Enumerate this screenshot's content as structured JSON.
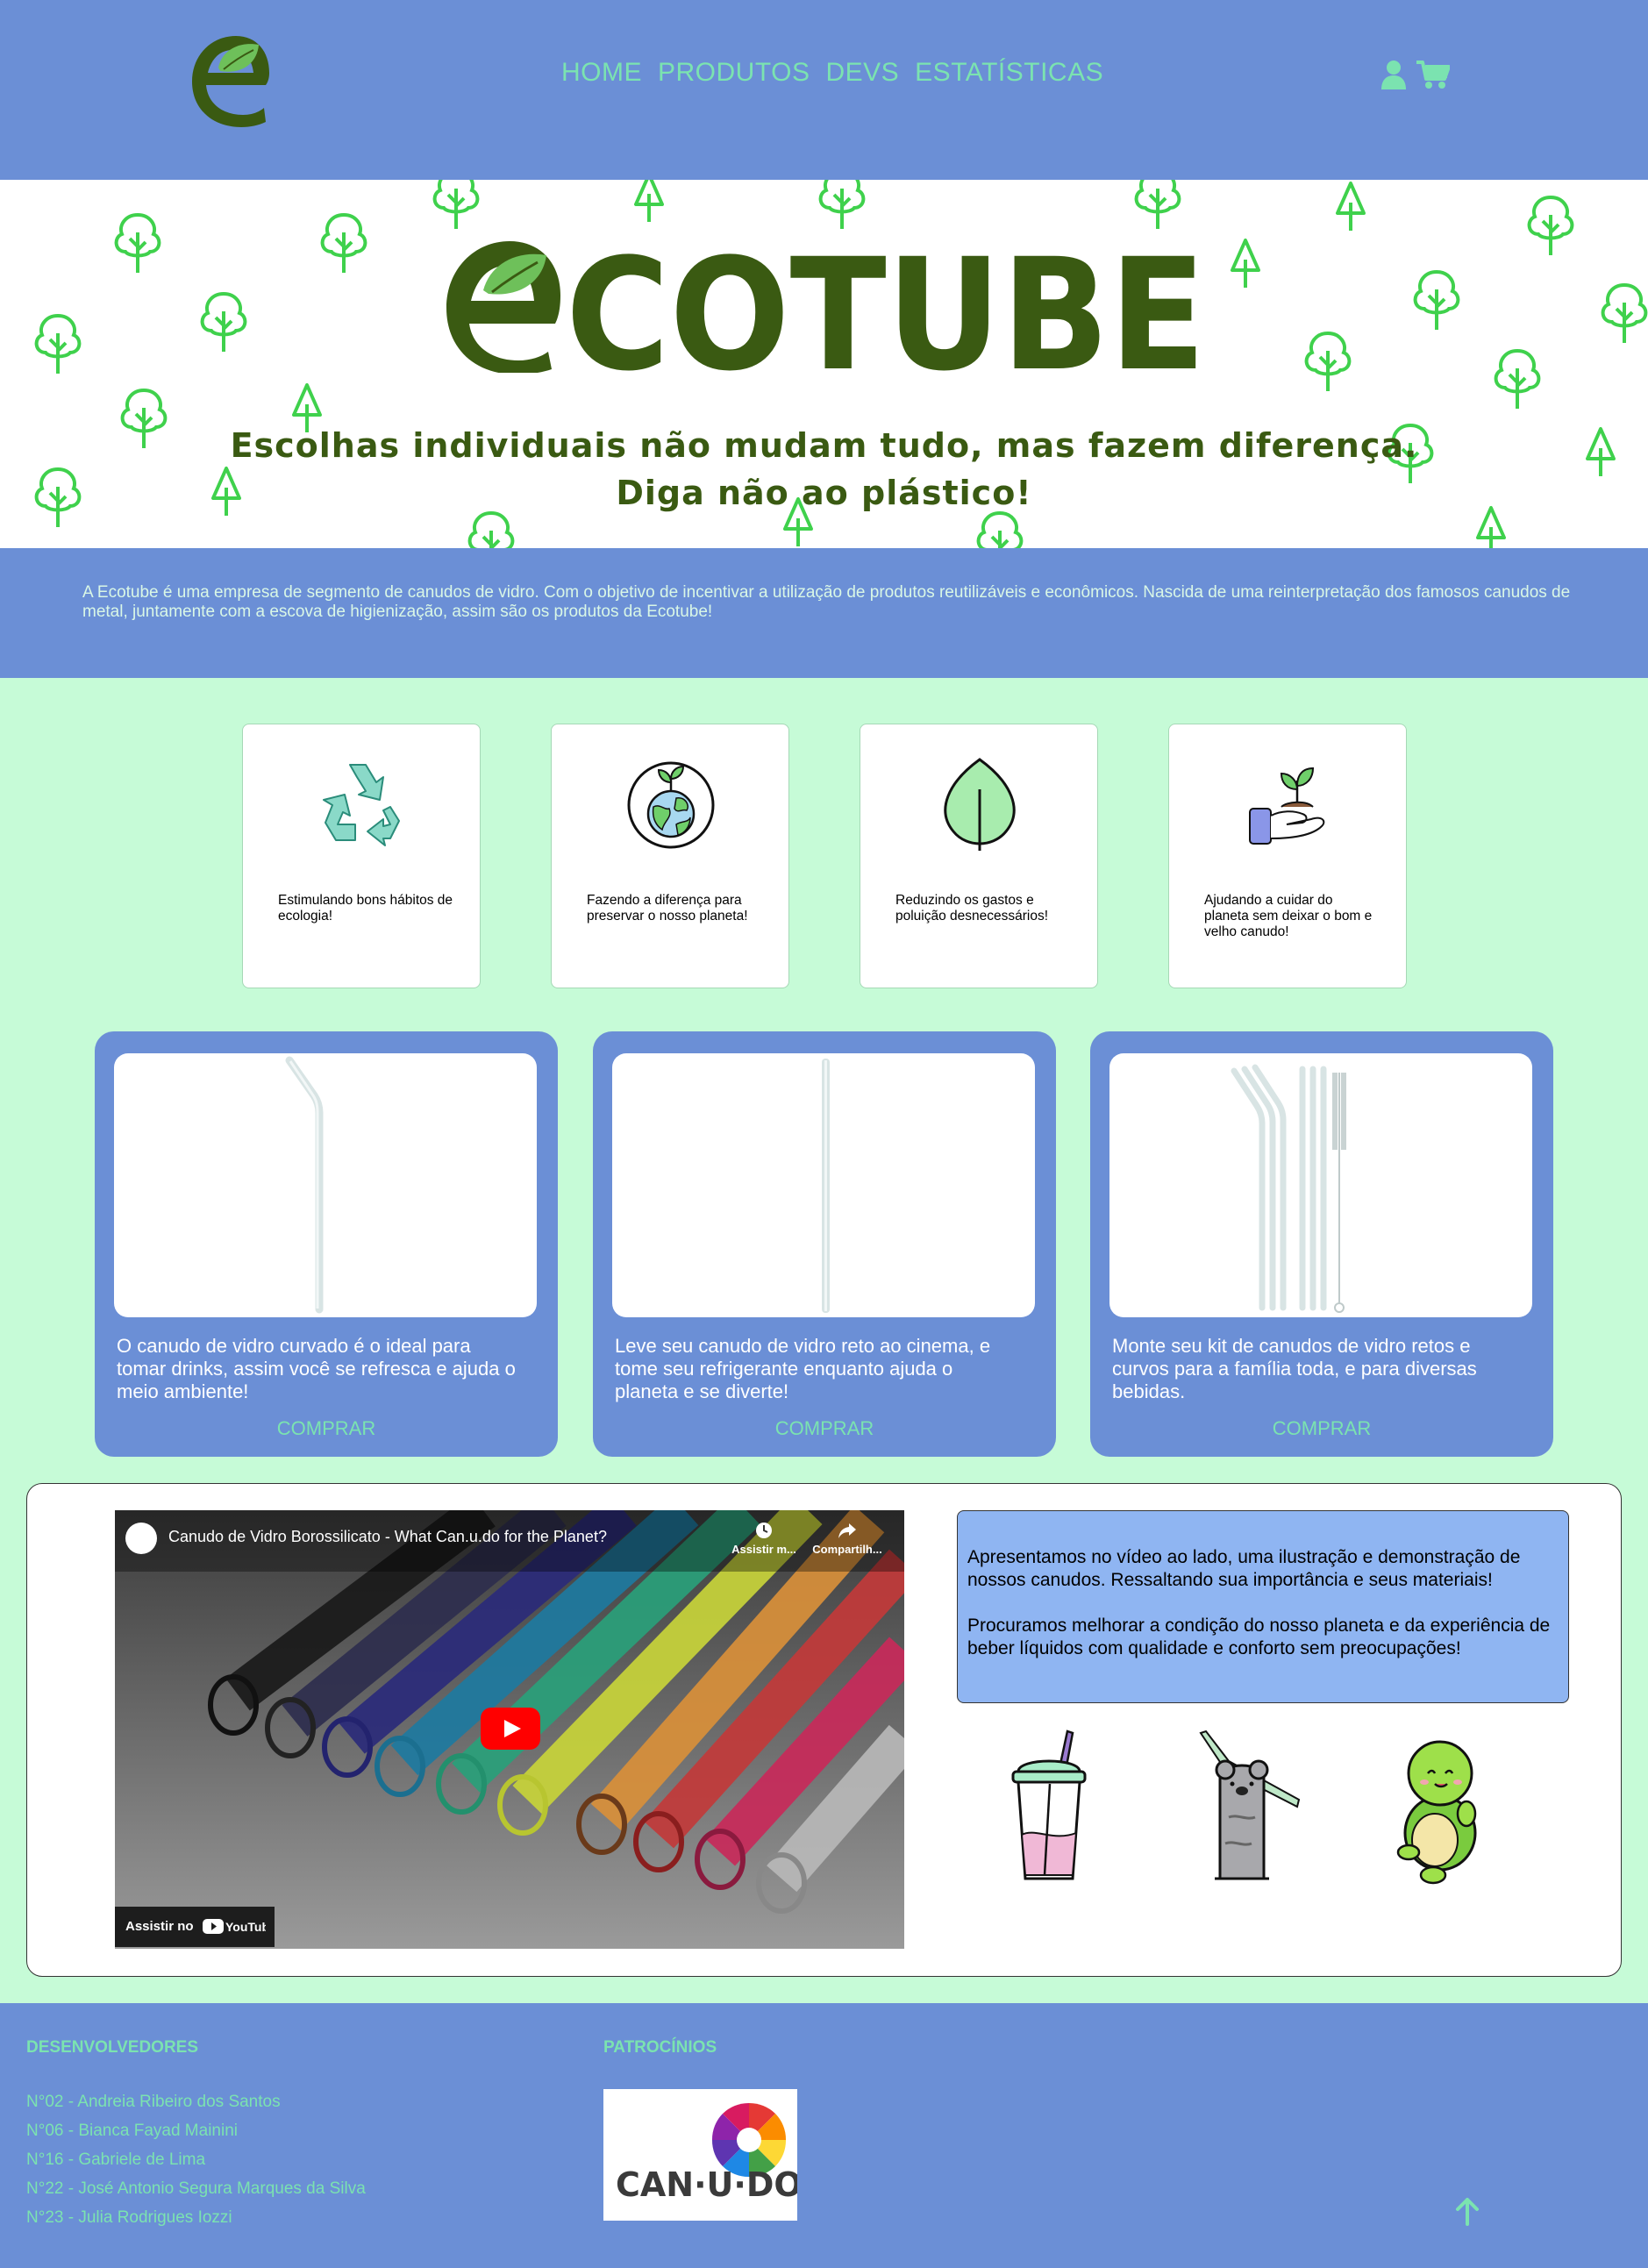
{
  "header": {
    "nav": [
      "HOME",
      "PRODUTOS",
      "DEVS",
      "ESTATÍSTICAS"
    ]
  },
  "hero": {
    "brand": "ECOTUBE",
    "tagline_line1": "Escolhas individuais não mudam tudo, mas fazem diferença.",
    "tagline_line2": "Diga não ao plástico!"
  },
  "about": {
    "text": "A Ecotube é uma empresa de segmento de canudos de vidro. Com o objetivo de incentivar a utilização de produtos reutilizáveis e econômicos. Nascida de uma reinterpretação dos famosos canudos de metal, juntamente com a escova de higienização, assim são os produtos da Ecotube!"
  },
  "features": [
    {
      "icon": "recycle-icon",
      "text": "Estimulando bons hábitos de ecologia!"
    },
    {
      "icon": "earth-sprout-icon",
      "text": "Fazendo a diferença para preservar o nosso planeta!"
    },
    {
      "icon": "leaf-icon",
      "text": "Reduzindo os gastos e poluição desnecessários!"
    },
    {
      "icon": "hand-plant-icon",
      "text": "Ajudando a cuidar do planeta sem deixar o bom e velho canudo!"
    }
  ],
  "products": [
    {
      "image": "curved-glass-straw",
      "description": "O canudo de vidro curvado é o ideal para tomar drinks, assim você se refresca e ajuda o meio ambiente!",
      "button": "COMPRAR"
    },
    {
      "image": "straight-glass-straw",
      "description": "Leve seu canudo de vidro reto ao cinema, e tome seu refrigerante enquanto ajuda o planeta e se diverte!",
      "button": "COMPRAR"
    },
    {
      "image": "straw-kit",
      "description": "Monte seu kit de canudos de vidro retos e curvos para a família toda, e para diversas bebidas.",
      "button": "COMPRAR"
    }
  ],
  "video": {
    "title": "Canudo de Vidro Borossilicato - What Can.u.do for the Planet?",
    "watch_later": "Assistir m...",
    "share": "Compartilh...",
    "watch_on": "Assistir no",
    "youtube": "YouTube"
  },
  "video_text": {
    "p1": "Apresentamos no vídeo ao lado, uma ilustração e demonstração de nossos canudos. Ressaltando sua importância e seus materiais!",
    "p2": "Procuramos melhorar a condição do nosso planeta e da experiência de beber líquidos com qualidade e conforto sem preocupações!"
  },
  "footer": {
    "devs_title": "DESENVOLVEDORES",
    "devs": [
      "N°02 - Andreia Ribeiro dos Santos",
      "N°06 - Bianca Fayad Mainini",
      "N°16 - Gabriele de Lima",
      "N°22 - José Antonio Segura Marques da Silva",
      "N°23 - Julia Rodrigues Iozzi"
    ],
    "sponsors_title": "PATROCÍNIOS",
    "sponsor_logo_text": "CAN·U·DO"
  },
  "colors": {
    "primary_blue": "#6b8fd6",
    "mint_background": "#c6fbd7",
    "link_green": "#7be3b0",
    "brand_dark_green": "#3a5a12"
  }
}
